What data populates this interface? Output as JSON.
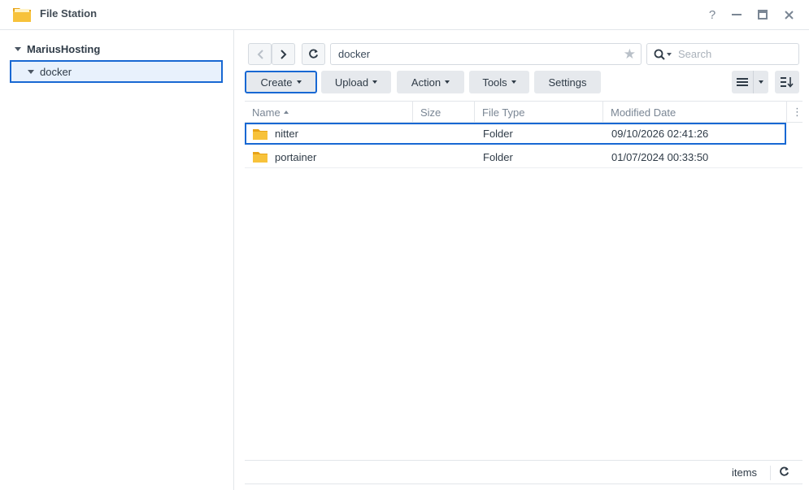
{
  "app": {
    "title": "File Station"
  },
  "window_controls": {
    "help": "?",
    "minimize": "—",
    "maximize": "□",
    "close": "✕"
  },
  "sidebar": {
    "root": {
      "label": "MariusHosting"
    },
    "items": [
      {
        "label": "docker"
      }
    ]
  },
  "toolbar": {
    "path": "docker",
    "search_placeholder": "Search",
    "buttons": [
      {
        "label": "Create"
      },
      {
        "label": "Upload"
      },
      {
        "label": "Action"
      },
      {
        "label": "Tools"
      },
      {
        "label": "Settings"
      }
    ]
  },
  "table": {
    "columns": [
      "Name",
      "Size",
      "File Type",
      "Modified Date"
    ],
    "rows": [
      {
        "name": "nitter",
        "size": "",
        "type": "Folder",
        "modified": "09/10/2026 02:41:26"
      },
      {
        "name": "portainer",
        "size": "",
        "type": "Folder",
        "modified": "01/07/2024 00:33:50"
      }
    ]
  },
  "footer": {
    "items_label": "items"
  },
  "colors": {
    "accent": "#1868d3",
    "folder": "#f7c23b",
    "selected_bg": "#e8f1fc"
  }
}
